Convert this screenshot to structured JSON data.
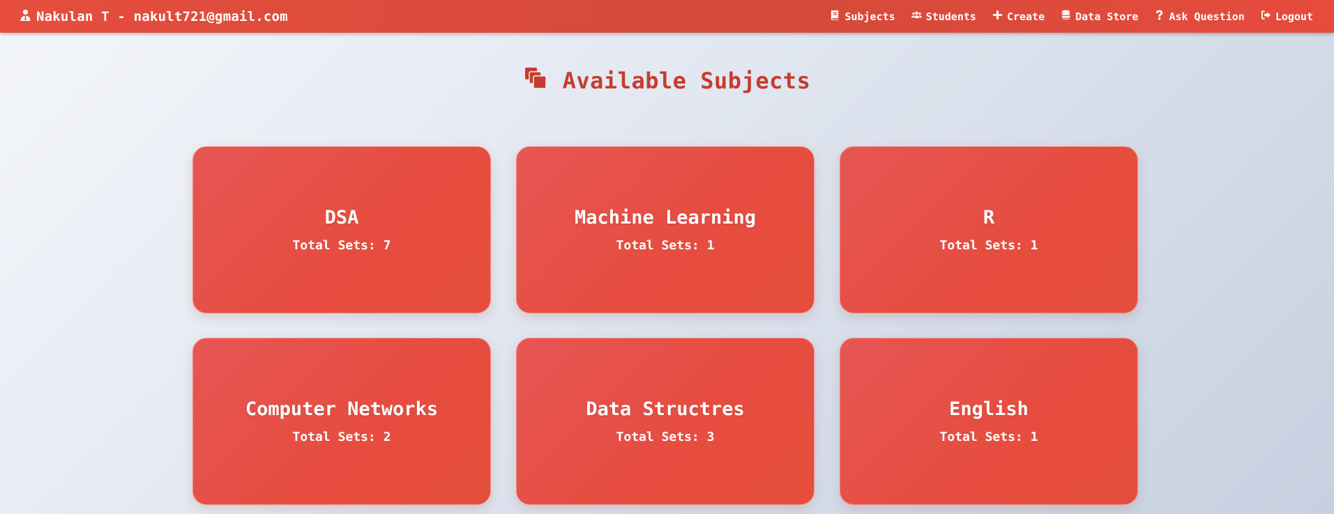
{
  "navbar": {
    "user_label": "Nakulan T - nakult721@gmail.com",
    "user_icon": "user-tie-icon",
    "links": [
      {
        "label": "Subjects",
        "icon": "book-icon"
      },
      {
        "label": "Students",
        "icon": "users-icon"
      },
      {
        "label": "Create",
        "icon": "plus-icon"
      },
      {
        "label": "Data Store",
        "icon": "database-icon"
      },
      {
        "label": "Ask Question",
        "icon": "question-icon"
      },
      {
        "label": "Logout",
        "icon": "logout-icon"
      }
    ]
  },
  "main": {
    "title": "Available Subjects",
    "title_icon": "clone-icon",
    "subjects": [
      {
        "name": "DSA",
        "sets_text": "Total Sets: 7"
      },
      {
        "name": "Machine Learning",
        "sets_text": "Total Sets: 1"
      },
      {
        "name": "R",
        "sets_text": "Total Sets: 1"
      },
      {
        "name": "Computer Networks",
        "sets_text": "Total Sets: 2"
      },
      {
        "name": "Data Structres",
        "sets_text": "Total Sets: 3"
      },
      {
        "name": "English",
        "sets_text": "Total Sets: 1"
      }
    ]
  },
  "colors": {
    "navbar": "#e04a3b",
    "accent": "#c63c2e",
    "card": "#e64f45"
  }
}
